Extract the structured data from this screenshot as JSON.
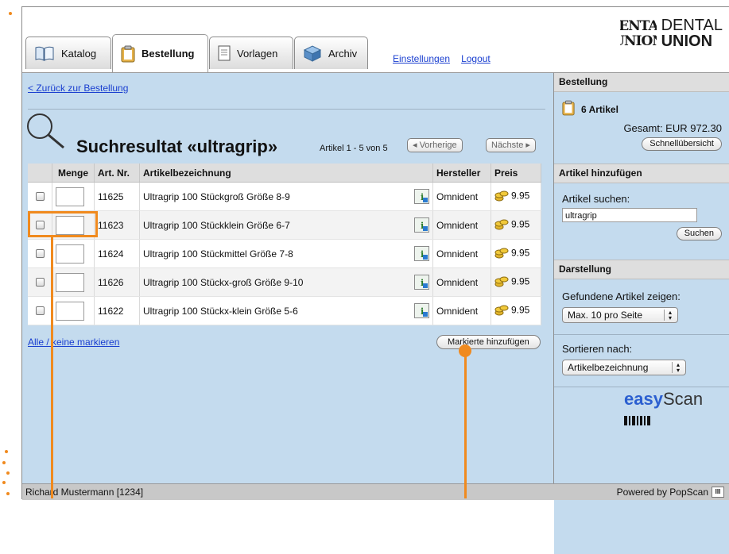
{
  "tabs": [
    {
      "label": "Katalog",
      "icon": "book-icon"
    },
    {
      "label": "Bestellung",
      "icon": "clipboard-icon"
    },
    {
      "label": "Vorlagen",
      "icon": "document-icon"
    },
    {
      "label": "Archiv",
      "icon": "box-icon"
    }
  ],
  "links": {
    "settings": "Einstellungen",
    "logout": "Logout"
  },
  "logo": {
    "mark": "DENTAL UNION",
    "line1": "DENTAL",
    "line2": "UNION"
  },
  "main": {
    "back": "Zurück zur Bestellung",
    "title": "Suchresultat «ultragrip»",
    "count": "Artikel 1 - 5 von 5",
    "prev": "Vorherige",
    "next": "Nächste",
    "columns": {
      "qty": "Menge",
      "artnr": "Art. Nr.",
      "desc": "Artikelbezeichnung",
      "maker": "Hersteller",
      "price": "Preis"
    },
    "rows": [
      {
        "artnr": "11625",
        "desc": "Ultragrip 100 Stückgroß Größe 8-9",
        "maker": "Omnident",
        "price": "9.95"
      },
      {
        "artnr": "11623",
        "desc": "Ultragrip 100 Stückklein Größe 6-7",
        "maker": "Omnident",
        "price": "9.95"
      },
      {
        "artnr": "11624",
        "desc": "Ultragrip 100 Stückmittel Größe 7-8",
        "maker": "Omnident",
        "price": "9.95"
      },
      {
        "artnr": "11626",
        "desc": "Ultragrip 100 Stückx-groß Größe 9-10",
        "maker": "Omnident",
        "price": "9.95"
      },
      {
        "artnr": "11622",
        "desc": "Ultragrip 100 Stückx-klein Größe 5-6",
        "maker": "Omnident",
        "price": "9.95"
      }
    ],
    "mark_all": "Alle / keine markieren",
    "add_marked": "Markierte hinzufügen"
  },
  "side": {
    "order_h": "Bestellung",
    "order_count": "6 Artikel",
    "order_total": "Gesamt: EUR 972.30",
    "overview_btn": "Schnellübersicht",
    "add_h": "Artikel hinzufügen",
    "search_label": "Artikel suchen:",
    "search_value": "ultragrip",
    "search_btn": "Suchen",
    "display_h": "Darstellung",
    "show_label": "Gefundene Artikel zeigen:",
    "show_value": "Max. 10 pro Seite",
    "sort_label": "Sortieren nach:",
    "sort_value": "Artikelbezeichnung",
    "brand_a": "easy",
    "brand_b": "Scan"
  },
  "footer": {
    "user": "Richard Mustermann [1234]",
    "powered": "Powered by PopScan"
  },
  "colors": {
    "panel": "#c4dbee",
    "link": "#1a3fd0",
    "annotation": "#f08a1e"
  }
}
